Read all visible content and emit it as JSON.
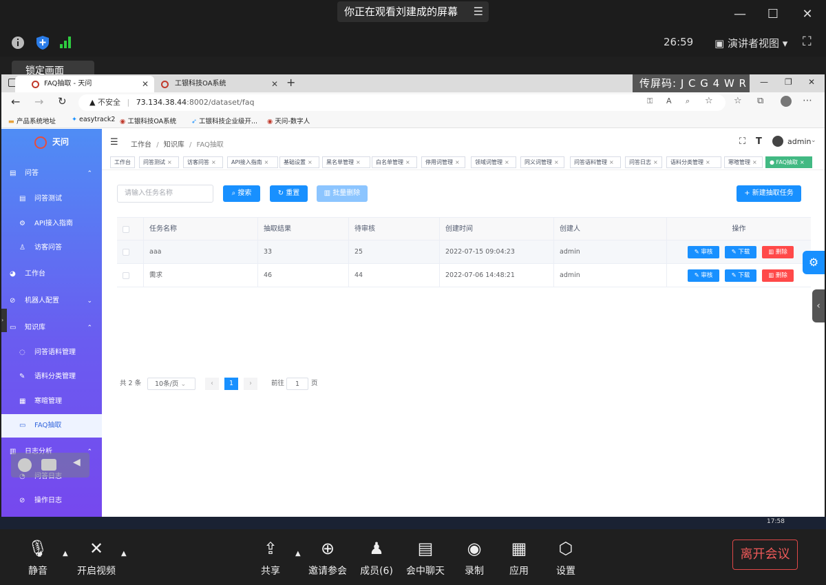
{
  "meeting": {
    "banner": "你正在观看刘建成的屏幕",
    "timer": "26:59",
    "presenter_view": "演讲者视图",
    "lock_label": "锁定画面",
    "share_code": "传屏码: J C G 4 W R",
    "toolbar": {
      "mute": "静音",
      "video": "开启视频",
      "share": "共享",
      "invite": "邀请参会",
      "members": "成员(6)",
      "chat": "会中聊天",
      "record": "录制",
      "apps": "应用",
      "settings": "设置",
      "leave": "离开会议"
    }
  },
  "browser": {
    "tabs": [
      {
        "title": "FAQ抽取 - 天问"
      },
      {
        "title": "工银科技OA系统"
      }
    ],
    "insecure": "不安全",
    "url_host": "73.134.38.44",
    "url_path": ":8002/dataset/faq",
    "bookmarks": [
      "产品系统地址",
      "easytrack2",
      "工银科技OA系统",
      "工银科技企业级开...",
      "天问-数字人"
    ]
  },
  "app": {
    "logo": "天问",
    "sidebar": [
      {
        "label": "问答",
        "type": "group"
      },
      {
        "label": "问答测试",
        "type": "sub"
      },
      {
        "label": "API接入指南",
        "type": "sub"
      },
      {
        "label": "访客问答",
        "type": "sub"
      },
      {
        "label": "工作台",
        "type": "group"
      },
      {
        "label": "机器人配置",
        "type": "group"
      },
      {
        "label": "知识库",
        "type": "group"
      },
      {
        "label": "问答语料管理",
        "type": "sub"
      },
      {
        "label": "语料分类管理",
        "type": "sub"
      },
      {
        "label": "寒暄管理",
        "type": "sub"
      },
      {
        "label": "FAQ抽取",
        "type": "sub"
      },
      {
        "label": "日志分析",
        "type": "group"
      },
      {
        "label": "问答日志",
        "type": "sub"
      },
      {
        "label": "操作日志",
        "type": "sub"
      }
    ],
    "breadcrumb": [
      "工作台",
      "知识库",
      "FAQ抽取"
    ],
    "user": "admin",
    "tags": [
      "工作台",
      "问答测试",
      "访客问答",
      "API接入指南",
      "基础设置",
      "黑名单管理",
      "白名单管理",
      "停用词管理",
      "领域词管理",
      "同义词管理",
      "问答语料管理",
      "问答日志",
      "语料分类管理",
      "寒暄管理",
      "FAQ抽取"
    ],
    "search_placeholder": "请输入任务名称",
    "buttons": {
      "search": "搜索",
      "reset": "重置",
      "batch_delete": "批量删除",
      "new_task": "新建抽取任务"
    },
    "table": {
      "columns": [
        "任务名称",
        "抽取结果",
        "待审核",
        "创建时间",
        "创建人",
        "操作"
      ],
      "rows": [
        {
          "name": "aaa",
          "result": "33",
          "pending": "25",
          "created": "2022-07-15 09:04:23",
          "creator": "admin"
        },
        {
          "name": "需求",
          "result": "46",
          "pending": "44",
          "created": "2022-07-06 14:48:21",
          "creator": "admin"
        }
      ],
      "actions": {
        "review": "审核",
        "download": "下载",
        "delete": "删除"
      }
    },
    "pagination": {
      "total": "共 2 条",
      "page_size": "10条/页",
      "current": "1",
      "goto_prefix": "前往",
      "goto_value": "1",
      "goto_suffix": "页"
    }
  },
  "taskbar": {
    "clock": "17:58"
  }
}
